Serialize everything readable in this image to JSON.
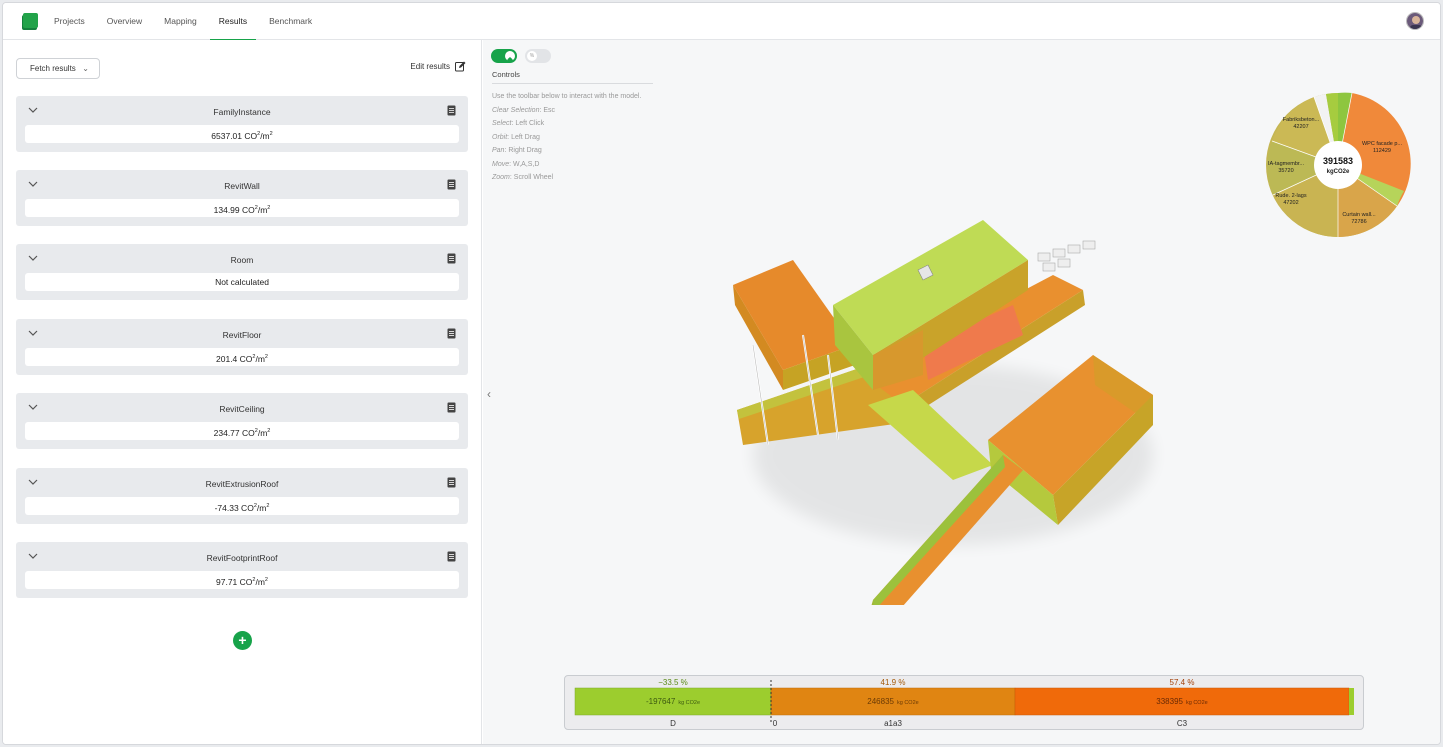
{
  "nav": {
    "items": [
      "Projects",
      "Overview",
      "Mapping",
      "Results",
      "Benchmark"
    ],
    "active": "Results"
  },
  "left": {
    "fetch_label": "Fetch results",
    "edit_label": "Edit results",
    "cards": [
      {
        "title": "FamilyInstance",
        "value": "6537.01 CO",
        "unit": "/m",
        "sup": "2",
        "sup2": "2"
      },
      {
        "title": "RevitWall",
        "value": "134.99 CO",
        "unit": "/m",
        "sup": "2",
        "sup2": "2"
      },
      {
        "title": "Room",
        "value": "Not calculated"
      },
      {
        "title": "RevitFloor",
        "value": "201.4 CO",
        "unit": "/m",
        "sup": "2",
        "sup2": "2"
      },
      {
        "title": "RevitCeiling",
        "value": "234.77 CO",
        "unit": "/m",
        "sup": "2",
        "sup2": "2"
      },
      {
        "title": "RevitExtrusionRoof",
        "value": "-74.33 CO",
        "unit": "/m",
        "sup": "2",
        "sup2": "2"
      },
      {
        "title": "RevitFootprintRoof",
        "value": "97.71 CO",
        "unit": "/m",
        "sup": "2",
        "sup2": "2"
      }
    ],
    "add_label": "+"
  },
  "viewer": {
    "toggle_off_label": "%",
    "controls_title": "Controls",
    "controls_intro": "Use the toolbar below to interact with the model.",
    "controls": [
      {
        "action": "Clear Selection",
        "key": "Esc"
      },
      {
        "action": "Select",
        "key": "Left Click"
      },
      {
        "action": "Orbit",
        "key": "Left Drag"
      },
      {
        "action": "Pan",
        "key": "Right Drag"
      },
      {
        "action": "Move",
        "key": "W,A,S,D"
      },
      {
        "action": "Zoom",
        "key": "Scroll Wheel"
      }
    ],
    "collapse_icon": "‹"
  },
  "donut": {
    "total": "391583",
    "unit": "kgCO2e",
    "slices": [
      {
        "label": "WPC facade p...",
        "value": "112429",
        "color": "#f0893a"
      },
      {
        "label": "Curtain wall...",
        "value": "72786",
        "color": "#d9a54a"
      },
      {
        "label": "Rude. 2-lags",
        "value": "47202",
        "color": "#c7b552"
      },
      {
        "label": "IA-tagmembr...",
        "value": "35720",
        "color": "#bfba55"
      },
      {
        "label": "Fabriksbeton...",
        "value": "42207",
        "color": "#c8b954"
      }
    ]
  },
  "phases": {
    "zero_label": "0",
    "items": [
      {
        "name": "D",
        "percent": "−33.5 %",
        "value": "-197647",
        "unit": "kg CO2e",
        "color": "#9ccd2e"
      },
      {
        "name": "a1a3",
        "percent": "41.9 %",
        "value": "246835",
        "unit": "kg CO2e",
        "color": "#e38614"
      },
      {
        "name": "C3",
        "percent": "57.4 %",
        "value": "338395",
        "unit": "kg CO2e",
        "color": "#f06a0a"
      }
    ]
  }
}
